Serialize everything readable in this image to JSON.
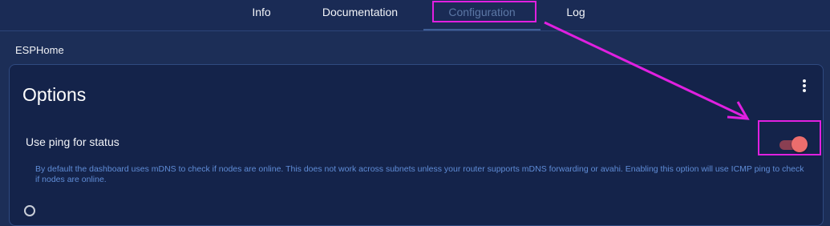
{
  "tabs": [
    {
      "label": "Info",
      "active": false
    },
    {
      "label": "Documentation",
      "active": false
    },
    {
      "label": "Configuration",
      "active": true
    },
    {
      "label": "Log",
      "active": false
    }
  ],
  "section": {
    "title": "ESPHome"
  },
  "options_card": {
    "title": "Options",
    "option": {
      "label": "Use ping for status",
      "description": "By default the dashboard uses mDNS to check if nodes are online. This does not work across subnets unless your router supports mDNS forwarding or avahi. Enabling this option will use ICMP ping to check if nodes are online.",
      "enabled": true
    }
  },
  "colors": {
    "annotation": "#e020e0",
    "toggle_on": "#ec6d6d",
    "background": "#1c2e57"
  },
  "icons": {
    "menu": "more-vert-icon"
  }
}
